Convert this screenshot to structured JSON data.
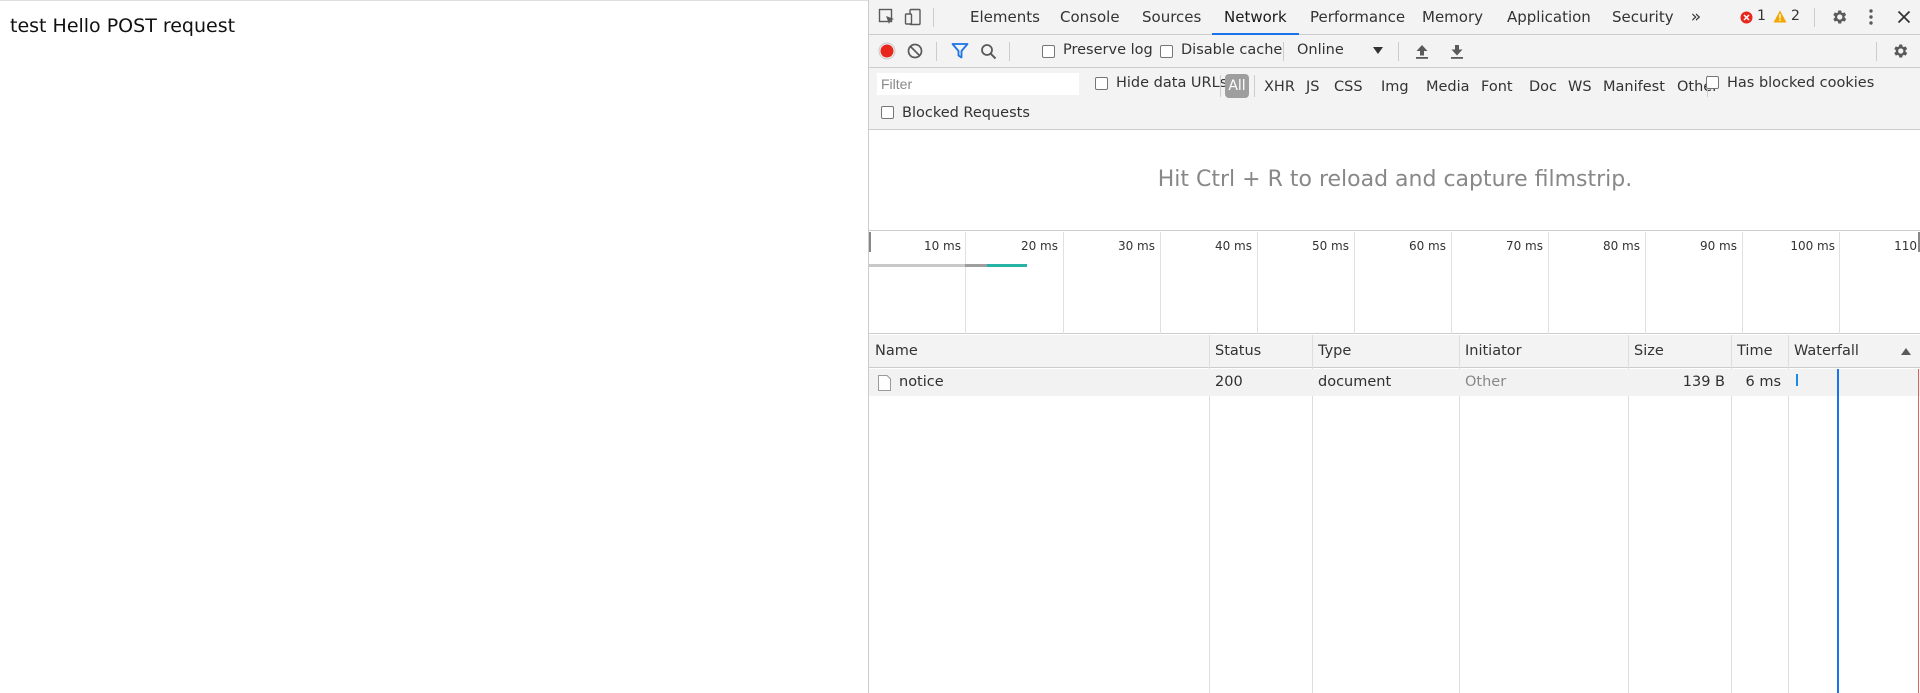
{
  "page": {
    "text": "test Hello POST request"
  },
  "devtools": {
    "tabs": [
      "Elements",
      "Console",
      "Sources",
      "Network",
      "Performance",
      "Memory",
      "Application",
      "Security"
    ],
    "active_tab": "Network",
    "error_count": "1",
    "warning_count": "2",
    "toolbar": {
      "preserve_log": "Preserve log",
      "disable_cache": "Disable cache",
      "throttling": "Online"
    },
    "filter": {
      "placeholder": "Filter",
      "hide_data_urls": "Hide data URLs",
      "types": [
        "All",
        "XHR",
        "JS",
        "CSS",
        "Img",
        "Media",
        "Font",
        "Doc",
        "WS",
        "Manifest",
        "Other"
      ],
      "has_blocked_cookies": "Has blocked cookies",
      "blocked_requests": "Blocked Requests"
    },
    "filmstrip_message": "Hit Ctrl + R to reload and capture filmstrip.",
    "overview_ticks": [
      "10 ms",
      "20 ms",
      "30 ms",
      "40 ms",
      "50 ms",
      "60 ms",
      "70 ms",
      "80 ms",
      "90 ms",
      "100 ms",
      "110"
    ],
    "table": {
      "columns": [
        "Name",
        "Status",
        "Type",
        "Initiator",
        "Size",
        "Time",
        "Waterfall"
      ],
      "rows": [
        {
          "name": "notice",
          "status": "200",
          "type": "document",
          "initiator": "Other",
          "size": "139 B",
          "time": "6 ms"
        }
      ]
    }
  },
  "colors": {
    "accent": "#1a73e8",
    "record": "#e8261c",
    "error": "#e8261c",
    "warning": "#f2a600"
  }
}
